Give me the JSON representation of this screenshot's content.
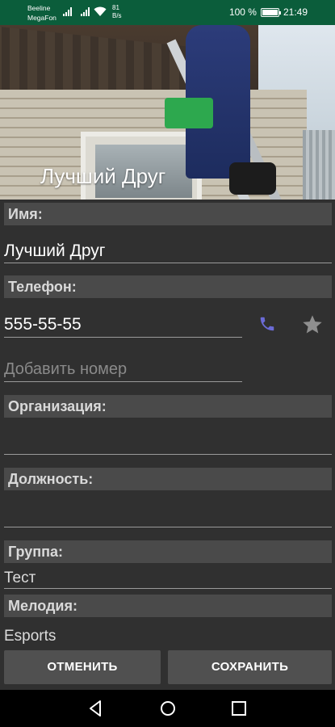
{
  "status_bar": {
    "carrier1": "Beeline",
    "carrier2": "MegaFon",
    "speed_value": "81",
    "speed_unit": "B/s",
    "battery": "100 %",
    "time": "21:49"
  },
  "header": {
    "title": "Лучший Друг"
  },
  "form": {
    "name_label": "Имя:",
    "name_value": "Лучший Друг",
    "phone_label": "Телефон:",
    "phone_value": "555-55-55",
    "add_number_placeholder": "Добавить номер",
    "org_label": "Организация:",
    "org_value": "",
    "position_label": "Должность:",
    "position_value": "",
    "group_label": "Группа:",
    "group_value": "Тест",
    "ringtone_label": "Мелодия:",
    "ringtone_value": "Esports"
  },
  "buttons": {
    "cancel": "ОТМЕНИТЬ",
    "save": "СОХРАНИТЬ"
  },
  "colors": {
    "status_bar": "#0b5d3b",
    "background": "#303030",
    "label_bg": "#4a4a4a",
    "call_icon": "#6b6bd6",
    "button_bg": "#505050"
  },
  "icons": [
    "signal-icon",
    "wifi-icon",
    "battery-icon",
    "phone-call-icon",
    "star-icon",
    "back-icon",
    "home-icon",
    "recents-icon"
  ]
}
